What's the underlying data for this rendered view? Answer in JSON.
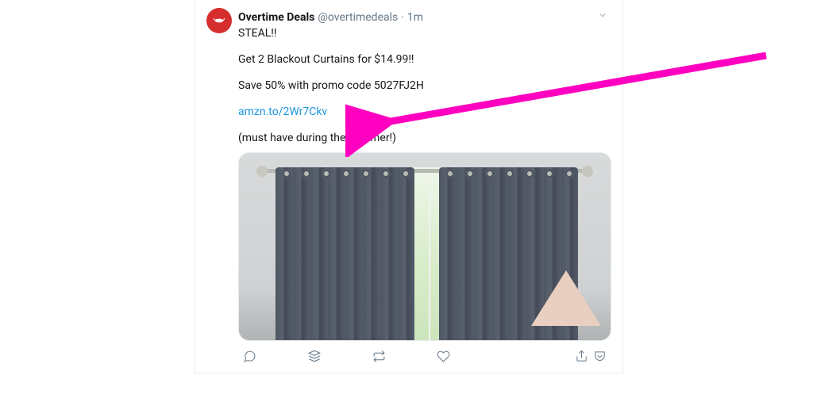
{
  "tweet": {
    "author": {
      "display_name": "Overtime Deals",
      "handle": "@overtimedeals"
    },
    "separator": "·",
    "timestamp": "1m",
    "lines": {
      "steal": "STEAL!!",
      "offer": "Get 2 Blackout Curtains for $14.99!!",
      "promo": "Save 50% with promo code 5027FJ2H",
      "link": "amzn.to/2Wr7Ckv",
      "note": "(must have during the summer!)"
    }
  },
  "colors": {
    "link": "#1b95e0",
    "annotation": "#ff00c1"
  }
}
